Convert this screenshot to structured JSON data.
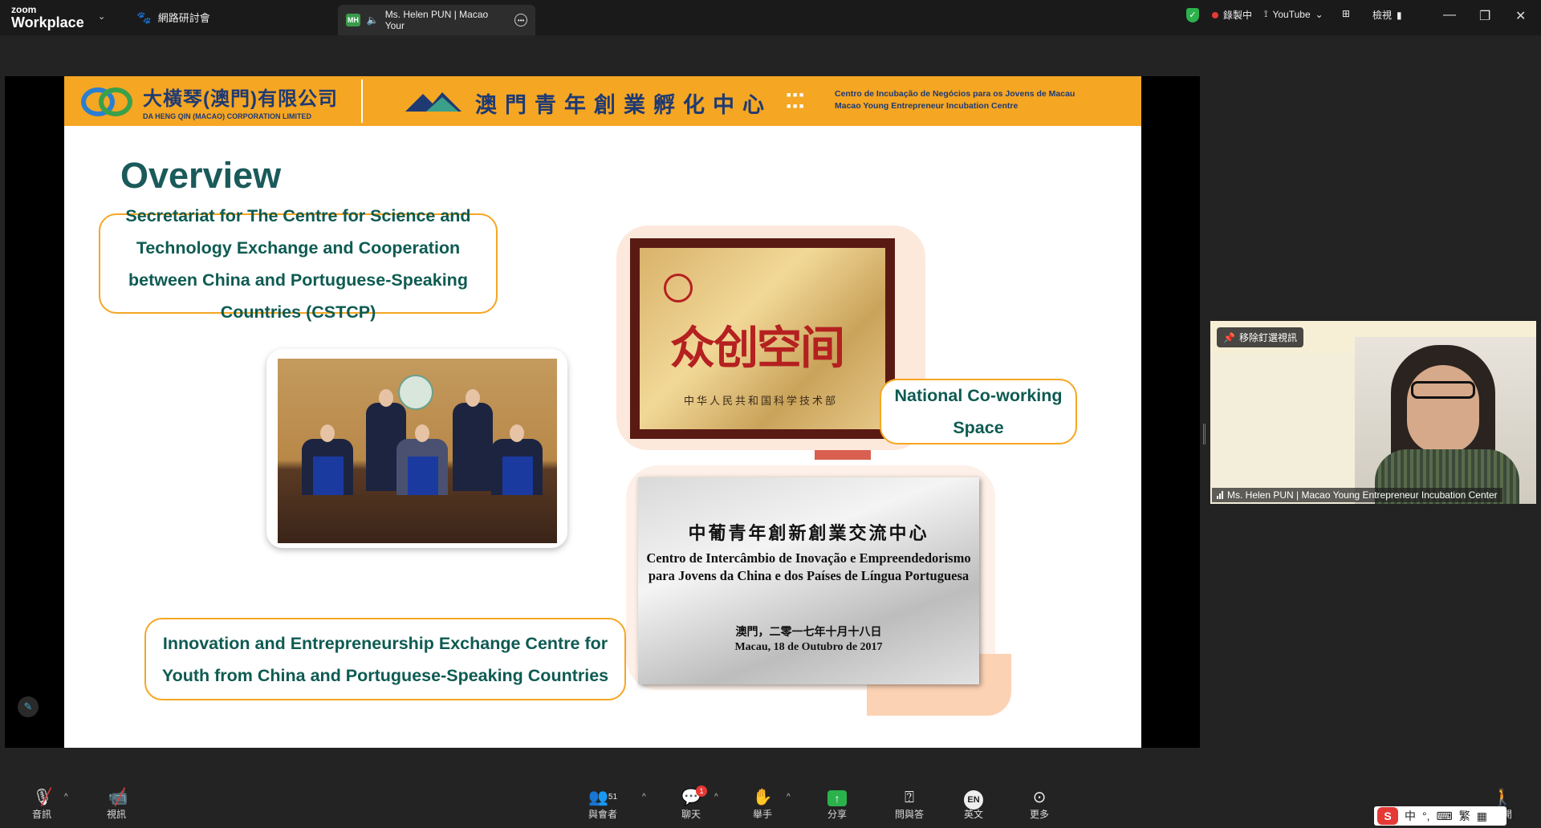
{
  "titlebar": {
    "logo_top": "zoom",
    "logo_bottom": "Workplace",
    "webinar_tab": "網路研討會",
    "active_tab_badge": "MH",
    "active_tab_title": "Ms. Helen PUN | Macao Your",
    "recording": "錄製中",
    "youtube": "YouTube",
    "view": "檢視"
  },
  "slide": {
    "company_cn": "大橫琴(澳門)有限公司",
    "company_en": "DA HENG QIN (MACAO) CORPORATION LIMITED",
    "incubation_cn": "澳門青年創業孵化中心",
    "incubation_pt": "Centro de Incubação de Negócios para os Jovens de Macau",
    "incubation_en": "Macao Young Entrepreneur Incubation Centre",
    "title": "Overview",
    "callout_1": "Secretariat for The Centre for Science and Technology Exchange and Cooperation between China and Portuguese-Speaking Countries (CSTCP)",
    "callout_2": "National Co-working Space",
    "callout_3": "Innovation and Entrepreneurship Exchange Centre for Youth from China and Portuguese-Speaking Countries",
    "gold_plaque_main": "众创空间",
    "gold_plaque_sub": "中华人民共和国科学技术部",
    "silver_plaque_cn": "中葡青年創新創業交流中心",
    "silver_plaque_pt": "Centro de Intercâmbio de Inovação e Empreendedorismo para Jovens da China e dos Países de Língua Portuguesa",
    "silver_plaque_date_cn": "澳門，二零一七年十月十八日",
    "silver_plaque_date_pt": "Macau, 18 de Outubro de 2017"
  },
  "video": {
    "unpin_label": "移除釘選視訊",
    "name": "Ms. Helen PUN | Macao Young Entrepreneur Incubation Center"
  },
  "toolbar": {
    "audio": "音訊",
    "video": "視訊",
    "participants": "與會者",
    "participants_count": "51",
    "chat": "聊天",
    "chat_badge": "1",
    "raise_hand": "舉手",
    "share": "分享",
    "qa": "問與答",
    "language": "英文",
    "language_code": "EN",
    "more": "更多",
    "leave": "離開"
  },
  "ime": {
    "mode": "中",
    "punct": "°,",
    "trad": "繁"
  }
}
